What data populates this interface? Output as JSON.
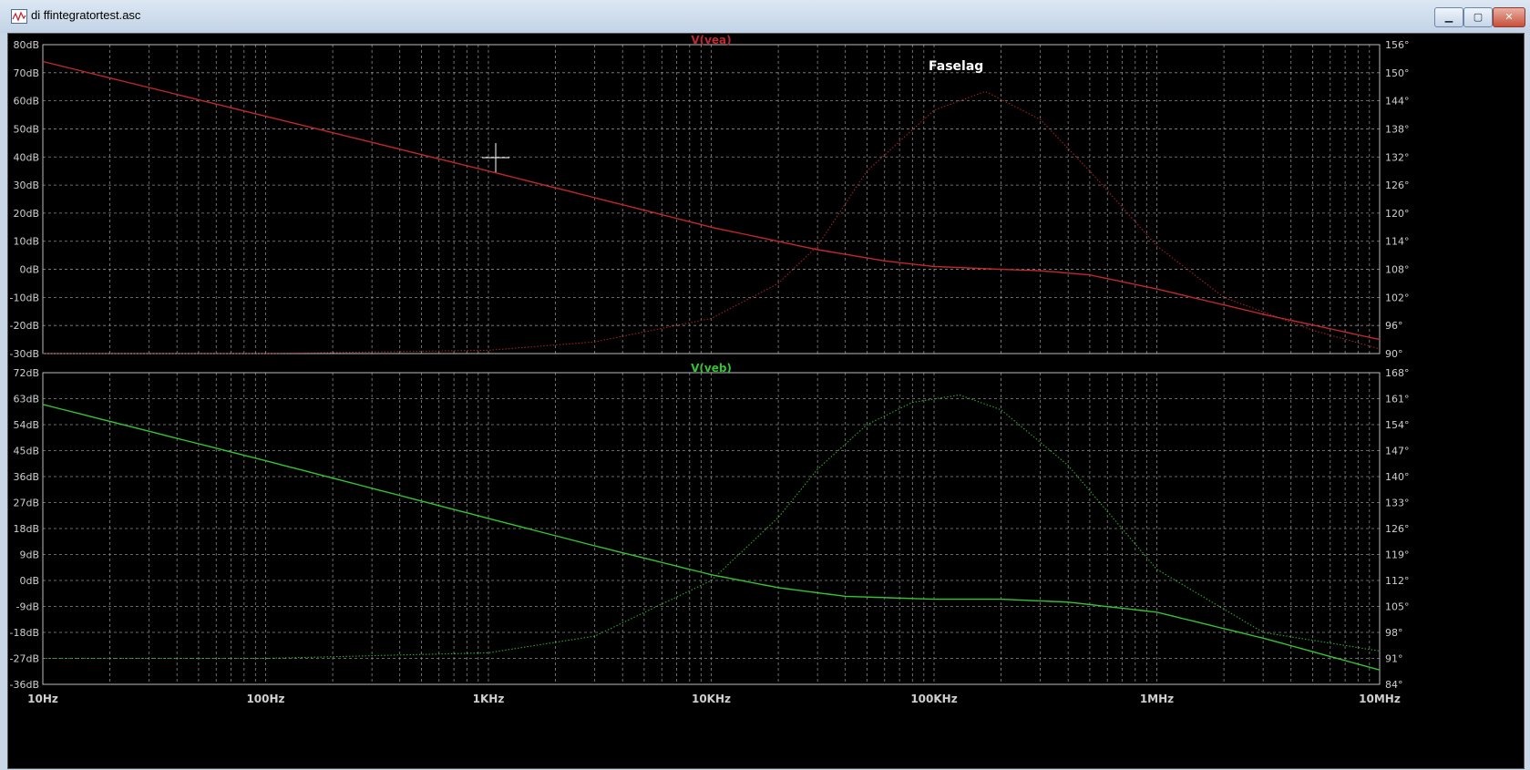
{
  "window": {
    "title": "di ffintegratortest.asc",
    "minimize_glyph": "▁",
    "maximize_glyph": "▢",
    "close_glyph": "✕",
    "app_icon": "waveform-icon"
  },
  "colors": {
    "background": "#000000",
    "grid": "#8a8a8a",
    "axis_text": "#cfcfcf",
    "trace_a": "#c0282d",
    "trace_b": "#33c433",
    "annotation": "#ffffff"
  },
  "chart_data": [
    {
      "type": "line",
      "title": "V(vea)",
      "x_scale": "log",
      "xlim": [
        10,
        10000000
      ],
      "x_ticks": [
        10,
        100,
        1000,
        10000,
        100000,
        1000000,
        10000000
      ],
      "x_tick_labels": [
        "10Hz",
        "100Hz",
        "1KHz",
        "10KHz",
        "100KHz",
        "1MHz",
        "10MHz"
      ],
      "left_axis": {
        "range": [
          -30,
          80
        ],
        "ticks": [
          80,
          70,
          60,
          50,
          40,
          30,
          20,
          10,
          0,
          -10,
          -20,
          -30
        ],
        "tick_labels": [
          "80dB",
          "70dB",
          "60dB",
          "50dB",
          "40dB",
          "30dB",
          "20dB",
          "10dB",
          "0dB",
          "-10dB",
          "-20dB",
          "-30dB"
        ]
      },
      "right_axis": {
        "range": [
          90,
          156
        ],
        "ticks": [
          156,
          150,
          144,
          138,
          132,
          126,
          120,
          114,
          108,
          102,
          96,
          90
        ],
        "tick_labels": [
          "156°",
          "150°",
          "144°",
          "138°",
          "132°",
          "126°",
          "120°",
          "114°",
          "108°",
          "102°",
          "96°",
          "90°"
        ]
      },
      "grid": true,
      "annotation": "Faselag",
      "series": [
        {
          "role": "magnitude",
          "style": "solid",
          "axis": "left",
          "x": [
            10,
            100,
            1000,
            3000,
            10000,
            30000,
            60000,
            100000,
            200000,
            300000,
            500000,
            1000000,
            3000000,
            10000000
          ],
          "y": [
            74,
            54.5,
            35,
            25.5,
            15,
            7,
            3,
            1,
            0,
            -0.5,
            -2,
            -7,
            -16,
            -25
          ]
        },
        {
          "role": "phase",
          "style": "dotted",
          "axis": "right",
          "x": [
            10,
            100,
            1000,
            3000,
            10000,
            20000,
            30000,
            50000,
            100000,
            170000,
            300000,
            500000,
            1000000,
            2000000,
            5000000,
            10000000
          ],
          "y": [
            90,
            90,
            90.7,
            92.5,
            97.5,
            105,
            113,
            129,
            142,
            146,
            140,
            129,
            113,
            102,
            95,
            91
          ]
        }
      ]
    },
    {
      "type": "line",
      "title": "V(veb)",
      "x_scale": "log",
      "xlim": [
        10,
        10000000
      ],
      "x_ticks": [
        10,
        100,
        1000,
        10000,
        100000,
        1000000,
        10000000
      ],
      "x_tick_labels": [
        "10Hz",
        "100Hz",
        "1KHz",
        "10KHz",
        "100KHz",
        "1MHz",
        "10MHz"
      ],
      "left_axis": {
        "range": [
          -36,
          72
        ],
        "ticks": [
          72,
          63,
          54,
          45,
          36,
          27,
          18,
          9,
          0,
          -9,
          -18,
          -27,
          -36
        ],
        "tick_labels": [
          "72dB",
          "63dB",
          "54dB",
          "45dB",
          "36dB",
          "27dB",
          "18dB",
          "9dB",
          "0dB",
          "-9dB",
          "-18dB",
          "-27dB",
          "-36dB"
        ]
      },
      "right_axis": {
        "range": [
          84,
          168
        ],
        "ticks": [
          168,
          161,
          154,
          147,
          140,
          133,
          126,
          119,
          112,
          105,
          98,
          91,
          84
        ],
        "tick_labels": [
          "168°",
          "161°",
          "154°",
          "147°",
          "140°",
          "133°",
          "126°",
          "119°",
          "112°",
          "105°",
          "98°",
          "91°",
          "84°"
        ]
      },
      "grid": true,
      "series": [
        {
          "role": "magnitude",
          "style": "solid",
          "axis": "left",
          "x": [
            10,
            100,
            1000,
            3000,
            10000,
            20000,
            40000,
            100000,
            200000,
            400000,
            1000000,
            3000000,
            10000000
          ],
          "y": [
            61,
            41.5,
            21.5,
            12,
            2,
            -2.5,
            -5.5,
            -6.5,
            -6.5,
            -7.5,
            -11,
            -20,
            -31
          ]
        },
        {
          "role": "phase",
          "style": "dotted",
          "axis": "right",
          "x": [
            10,
            100,
            1000,
            3000,
            10000,
            20000,
            30000,
            50000,
            80000,
            130000,
            200000,
            400000,
            1000000,
            3000000,
            10000000
          ],
          "y": [
            91,
            91,
            92.5,
            97,
            112,
            129,
            142,
            154,
            160,
            162,
            158,
            143,
            115,
            98,
            93
          ]
        }
      ]
    }
  ]
}
